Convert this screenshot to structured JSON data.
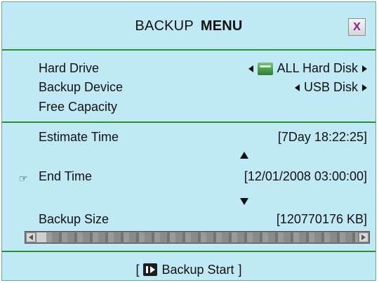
{
  "title": {
    "left": "BACKUP",
    "right": "MENU",
    "close_symbol": "X"
  },
  "rows": {
    "hard_drive": {
      "label": "Hard Drive",
      "value": "ALL Hard Disk"
    },
    "backup_device": {
      "label": "Backup Device",
      "value": "USB Disk"
    },
    "free_capacity": {
      "label": "Free Capacity",
      "value": ""
    },
    "estimate_time": {
      "label": "Estimate Time",
      "value": "[7Day 18:22:25]"
    },
    "end_time": {
      "label": "End Time",
      "value": "[12/01/2008 03:00:00]"
    },
    "backup_size": {
      "label": "Backup Size",
      "value": "[120770176 KB]"
    }
  },
  "start": {
    "prefix": "[",
    "label": "Backup Start",
    "suffix": "]"
  },
  "progress": {
    "fraction": 0.03
  },
  "colors": {
    "panel": "#bfe9f5",
    "separator": "#2f8f2f",
    "close_x": "#8a1b8e"
  },
  "icons": {
    "hard_drive_icon": "hdd-icon",
    "cursor_icon": "pointer-hand-icon",
    "start_icon": "play-pause-icon"
  }
}
